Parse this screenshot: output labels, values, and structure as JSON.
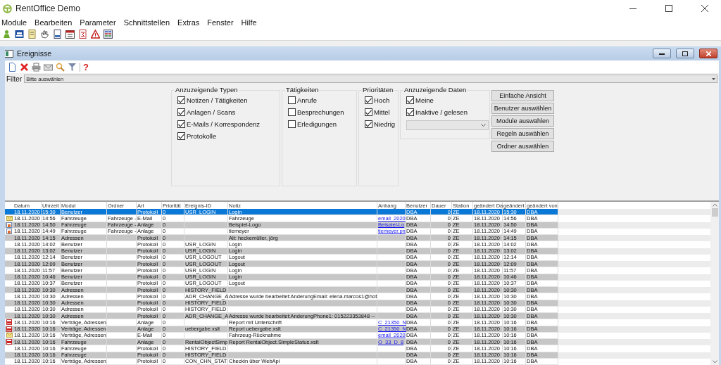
{
  "window": {
    "title": "RentOffice Demo"
  },
  "menu": [
    "Module",
    "Bearbeiten",
    "Parameter",
    "Schnittstellen",
    "Extras",
    "Fenster",
    "Hilfe"
  ],
  "child_window": {
    "title": "Ereignisse",
    "help": "?"
  },
  "filter": {
    "label": "Filter",
    "value": "Bitte auswählen"
  },
  "groups": [
    {
      "title": "Anzuzeigende Typen",
      "items": [
        {
          "label": "Notizen / Tätigkeiten",
          "checked": true
        },
        {
          "label": "Anlagen / Scans",
          "checked": true
        },
        {
          "label": "E-Mails / Korrespondenz",
          "checked": true
        },
        {
          "label": "Protokolle",
          "checked": true
        }
      ]
    },
    {
      "title": "Tätigkeiten",
      "items": [
        {
          "label": "Anrufe",
          "checked": false
        },
        {
          "label": "Besprechungen",
          "checked": false
        },
        {
          "label": "Erledigungen",
          "checked": false
        }
      ]
    },
    {
      "title": "Prioritäten",
      "items": [
        {
          "label": "Hoch",
          "checked": true
        },
        {
          "label": "Mittel",
          "checked": true
        },
        {
          "label": "Niedrig",
          "checked": true
        }
      ]
    },
    {
      "title": "Anzuzeigende Daten",
      "items": [
        {
          "label": "Meine",
          "checked": true
        },
        {
          "label": "Inaktive / gelesen",
          "checked": true
        }
      ]
    }
  ],
  "buttons": [
    "Einfache Ansicht",
    "Benutzer auswählen",
    "Module auswählen",
    "Regeln auswählen",
    "Ordner auswählen"
  ],
  "table": {
    "columns": [
      {
        "label": "Datum",
        "kind": "text"
      },
      {
        "label": "Uhrzeit",
        "kind": "text"
      },
      {
        "label": "Modul",
        "kind": "text"
      },
      {
        "label": "Ordner",
        "kind": "text"
      },
      {
        "label": "Art",
        "kind": "text"
      },
      {
        "label": "Priorität",
        "kind": "text"
      },
      {
        "label": "Ereignis-ID",
        "kind": "text"
      },
      {
        "label": "Notiz",
        "kind": "text"
      },
      {
        "label": "Anhang",
        "kind": "link"
      },
      {
        "label": "Benutzer",
        "kind": "text"
      },
      {
        "label": "Dauer",
        "kind": "number"
      },
      {
        "label": "Station",
        "kind": "text"
      },
      {
        "label": "geändert Da",
        "kind": "text"
      },
      {
        "label": "geändert",
        "kind": "text"
      },
      {
        "label": "geändert von",
        "kind": "text"
      }
    ],
    "rows": [
      {
        "selected": true,
        "kind": "plain",
        "cells": [
          "18.11.2020",
          "15:30",
          "Benutzer",
          "",
          "Protokoll",
          "0",
          "USR_LOGIN",
          "Login",
          "",
          "DBA",
          "0",
          "ZE",
          "18.11.2020",
          "15:30",
          "DBA"
        ]
      },
      {
        "selected": false,
        "kind": "email",
        "cells": [
          "18.11.2020",
          "14:56",
          "Fahrzeuge",
          "Fahrzeuge -",
          "E-Mail",
          "0",
          "",
          "Fahrzeuge",
          "email_2020",
          "DBA",
          "0",
          "ZE",
          "18.11.2020",
          "14:56",
          "DBA"
        ]
      },
      {
        "selected": false,
        "kind": "image",
        "cells": [
          "18.11.2020",
          "14:50",
          "Fahrzeuge",
          "Fahrzeuge -",
          "Anlage",
          "0",
          "",
          "Beispiel-Logo",
          "Beispiel-Lo",
          "DBA",
          "0",
          "ZE",
          "18.11.2020",
          "14:50",
          "DBA"
        ]
      },
      {
        "selected": false,
        "kind": "image",
        "cells": [
          "18.11.2020",
          "14:49",
          "Fahrzeuge",
          "Fahrzeuge -",
          "Anlage",
          "0",
          "",
          "tiemeyer",
          "tiemeyer.pn",
          "DBA",
          "0",
          "ZE",
          "18.11.2020",
          "14:49",
          "DBA"
        ]
      },
      {
        "selected": false,
        "kind": "plain",
        "cells": [
          "18.11.2020",
          "14:15",
          "Adressen",
          "",
          "Protokoll",
          "0",
          "",
          "Alt: heckemüller, jörg",
          "",
          "DBA",
          "0",
          "ZE",
          "18.11.2020",
          "14:15",
          "DBA"
        ]
      },
      {
        "selected": false,
        "kind": "plain",
        "cells": [
          "18.11.2020",
          "14:02",
          "Benutzer",
          "",
          "Protokoll",
          "0",
          "USR_LOGIN",
          "Login",
          "",
          "DBA",
          "0",
          "ZE",
          "18.11.2020",
          "14:02",
          "DBA"
        ]
      },
      {
        "selected": false,
        "kind": "plain",
        "cells": [
          "18.11.2020",
          "13:02",
          "Benutzer",
          "",
          "Protokoll",
          "0",
          "USR_LOGIN",
          "Login",
          "",
          "DBA",
          "0",
          "ZE",
          "18.11.2020",
          "13:02",
          "DBA"
        ]
      },
      {
        "selected": false,
        "kind": "plain",
        "cells": [
          "18.11.2020",
          "12:14",
          "Benutzer",
          "",
          "Protokoll",
          "0",
          "USR_LOGOUT",
          "Logout",
          "",
          "DBA",
          "0",
          "ZE",
          "18.11.2020",
          "12:14",
          "DBA"
        ]
      },
      {
        "selected": false,
        "kind": "plain",
        "cells": [
          "18.11.2020",
          "12:09",
          "Benutzer",
          "",
          "Protokoll",
          "0",
          "USR_LOGOUT",
          "Logout",
          "",
          "DBA",
          "0",
          "ZE",
          "18.11.2020",
          "12:09",
          "DBA"
        ]
      },
      {
        "selected": false,
        "kind": "plain",
        "cells": [
          "18.11.2020",
          "11:57",
          "Benutzer",
          "",
          "Protokoll",
          "0",
          "USR_LOGIN",
          "Login",
          "",
          "DBA",
          "0",
          "ZE",
          "18.11.2020",
          "11:57",
          "DBA"
        ]
      },
      {
        "selected": false,
        "kind": "plain",
        "cells": [
          "18.11.2020",
          "10:46",
          "Benutzer",
          "",
          "Protokoll",
          "0",
          "USR_LOGIN",
          "Login",
          "",
          "DBA",
          "0",
          "ZE",
          "18.11.2020",
          "10:46",
          "DBA"
        ]
      },
      {
        "selected": false,
        "kind": "plain",
        "cells": [
          "18.11.2020",
          "10:37",
          "Benutzer",
          "",
          "Protokoll",
          "0",
          "USR_LOGOUT",
          "Logout",
          "",
          "DBA",
          "0",
          "ZE",
          "18.11.2020",
          "10:37",
          "DBA"
        ]
      },
      {
        "selected": false,
        "kind": "plain",
        "cells": [
          "18.11.2020",
          "10:30",
          "Adressen",
          "",
          "Protokoll",
          "0",
          "HISTORY_FIELD",
          "",
          "",
          "DBA",
          "0",
          "ZE",
          "18.11.2020",
          "10:30",
          "DBA"
        ]
      },
      {
        "selected": false,
        "kind": "plain",
        "cells": [
          "18.11.2020",
          "10:30",
          "Adressen",
          "",
          "Protokoll",
          "0",
          "ADR_CHANGE_A",
          "Adresse wurde bearbeitet:AnderungEmail: elena.marcos1@hot",
          "",
          "DBA",
          "0",
          "ZE",
          "18.11.2020",
          "10:30",
          "DBA"
        ]
      },
      {
        "selected": false,
        "kind": "plain",
        "cells": [
          "18.11.2020",
          "10:30",
          "Adressen",
          "",
          "Protokoll",
          "0",
          "HISTORY_FIELD",
          "",
          "",
          "DBA",
          "0",
          "ZE",
          "18.11.2020",
          "10:30",
          "DBA"
        ]
      },
      {
        "selected": false,
        "kind": "plain",
        "cells": [
          "18.11.2020",
          "10:30",
          "Adressen",
          "",
          "Protokoll",
          "0",
          "HISTORY_FIELD",
          "",
          "",
          "DBA",
          "0",
          "ZE",
          "18.11.2020",
          "10:30",
          "DBA"
        ]
      },
      {
        "selected": false,
        "kind": "plain",
        "cells": [
          "18.11.2020",
          "10:30",
          "Adressen",
          "",
          "Protokoll",
          "0",
          "ADR_CHANGE_A",
          "Adresse wurde bearbeitet:AnderungPhone1: 015223353848 --",
          "",
          "DBA",
          "0",
          "ZE",
          "18.11.2020",
          "10:30",
          "DBA"
        ]
      },
      {
        "selected": false,
        "kind": "pdf",
        "cells": [
          "18.11.2020",
          "10:16",
          "Verträge, Adressen",
          "",
          "Anlage",
          "0",
          "",
          "Report mit Unterschrift",
          "C_21350_N",
          "DBA",
          "0",
          "ZE",
          "18.11.2020",
          "10:16",
          "DBA"
        ]
      },
      {
        "selected": false,
        "kind": "pdf",
        "cells": [
          "18.11.2020",
          "10:16",
          "Verträge, Adressen",
          "",
          "Anlage",
          "0",
          "uebergabe.xslt",
          "Report uebergabe.xslt",
          "C_21350_N",
          "DBA",
          "0",
          "ZE",
          "18.11.2020",
          "10:16",
          "DBA"
        ]
      },
      {
        "selected": false,
        "kind": "email",
        "cells": [
          "18.11.2020",
          "10:16",
          "Verträge, Adressen",
          "",
          "E-Mail",
          "0",
          "",
          "Fahrzeug-Rücknahme",
          "email_2020",
          "DBA",
          "0",
          "ZE",
          "18.11.2020",
          "10:16",
          "DBA"
        ]
      },
      {
        "selected": false,
        "kind": "pdf",
        "cells": [
          "18.11.2020",
          "10:16",
          "Fahrzeuge",
          "",
          "Anlage",
          "0",
          "RentalObjectSimp",
          "Report RentalObject.SimpleStatus.xslt",
          "O_33_D_8",
          "DBA",
          "0",
          "ZE",
          "18.11.2020",
          "10:16",
          "DBA"
        ]
      },
      {
        "selected": false,
        "kind": "plain",
        "cells": [
          "18.11.2020",
          "10:16",
          "Fahrzeuge",
          "",
          "Protokoll",
          "0",
          "HISTORY_FIELD",
          "",
          "",
          "DBA",
          "0",
          "ZE",
          "18.11.2020",
          "10:16",
          "DBA"
        ]
      },
      {
        "selected": false,
        "kind": "plain",
        "cells": [
          "18.11.2020",
          "10:16",
          "Fahrzeuge",
          "",
          "Protokoll",
          "0",
          "HISTORY_FIELD",
          "",
          "",
          "DBA",
          "0",
          "ZE",
          "18.11.2020",
          "10:16",
          "DBA"
        ]
      },
      {
        "selected": false,
        "kind": "plain",
        "cells": [
          "18.11.2020",
          "10:16",
          "Verträge, Adressen",
          "",
          "Protokoll",
          "0",
          "CON_CHN_STAT",
          "Checkin über WebApi",
          "",
          "DBA",
          "0",
          "ZE",
          "18.11.2020",
          "10:16",
          "DBA"
        ]
      }
    ]
  }
}
